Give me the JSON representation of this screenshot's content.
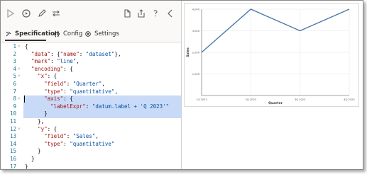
{
  "tabs": [
    {
      "label": "Specification",
      "icon": "tools-icon"
    },
    {
      "label": "Config",
      "icon": "braces-icon"
    },
    {
      "label": "Settings",
      "icon": "gear-icon"
    }
  ],
  "code_lines": [
    {
      "n": "1",
      "segs": [
        [
          "p",
          "{"
        ]
      ]
    },
    {
      "n": "2",
      "segs": [
        [
          "p",
          "  "
        ],
        [
          "k",
          "\"data\""
        ],
        [
          "p",
          ": {"
        ],
        [
          "k",
          "\"name\""
        ],
        [
          "p",
          ": "
        ],
        [
          "s",
          "\"dataset\""
        ],
        [
          "p",
          "},"
        ]
      ]
    },
    {
      "n": "3",
      "segs": [
        [
          "p",
          "  "
        ],
        [
          "k",
          "\"mark\""
        ],
        [
          "p",
          ": "
        ],
        [
          "s",
          "\"line\""
        ],
        [
          "p",
          ","
        ]
      ]
    },
    {
      "n": "4",
      "segs": [
        [
          "p",
          "  "
        ],
        [
          "k",
          "\"encoding\""
        ],
        [
          "p",
          ": {"
        ]
      ]
    },
    {
      "n": "5",
      "segs": [
        [
          "p",
          "    "
        ],
        [
          "k",
          "\"x\""
        ],
        [
          "p",
          ": {"
        ]
      ]
    },
    {
      "n": "6",
      "segs": [
        [
          "p",
          "      "
        ],
        [
          "k",
          "\"field\""
        ],
        [
          "p",
          ": "
        ],
        [
          "s",
          "\"Quarter\""
        ],
        [
          "p",
          ","
        ]
      ]
    },
    {
      "n": "7",
      "segs": [
        [
          "p",
          "      "
        ],
        [
          "k",
          "\"type\""
        ],
        [
          "p",
          ": "
        ],
        [
          "s",
          "\"quantitative\""
        ],
        [
          "p",
          ","
        ]
      ]
    },
    {
      "n": "8",
      "segs": [
        [
          "p",
          "      "
        ],
        [
          "k",
          "\"axis\""
        ],
        [
          "p",
          ": {"
        ]
      ]
    },
    {
      "n": "9",
      "segs": [
        [
          "p",
          "        "
        ],
        [
          "k",
          "\"labelExpr\""
        ],
        [
          "p",
          ": "
        ],
        [
          "s",
          "\"datum.label + 'Q 2023'\""
        ]
      ]
    },
    {
      "n": "10",
      "segs": [
        [
          "p",
          "      }"
        ]
      ]
    },
    {
      "n": "11",
      "segs": [
        [
          "p",
          "    },"
        ]
      ]
    },
    {
      "n": "12",
      "segs": [
        [
          "p",
          "    "
        ],
        [
          "k",
          "\"y\""
        ],
        [
          "p",
          ": {"
        ]
      ]
    },
    {
      "n": "13",
      "segs": [
        [
          "p",
          "      "
        ],
        [
          "k",
          "\"field\""
        ],
        [
          "p",
          ": "
        ],
        [
          "s",
          "\"Sales\""
        ],
        [
          "p",
          ","
        ]
      ]
    },
    {
      "n": "14",
      "segs": [
        [
          "p",
          "      "
        ],
        [
          "k",
          "\"type\""
        ],
        [
          "p",
          ": "
        ],
        [
          "s",
          "\"quantitative\""
        ]
      ]
    },
    {
      "n": "15",
      "segs": [
        [
          "p",
          "    }"
        ]
      ]
    },
    {
      "n": "16",
      "segs": [
        [
          "p",
          "  }"
        ]
      ]
    },
    {
      "n": "17",
      "segs": [
        [
          "p",
          "}"
        ]
      ]
    }
  ],
  "selected_lines": [
    8,
    9,
    10
  ],
  "fold_lines": [
    1,
    4,
    5,
    8,
    12
  ],
  "chart_data": {
    "type": "line",
    "x": [
      1,
      2,
      3,
      4
    ],
    "values": [
      2000,
      4000,
      3000,
      4000
    ],
    "x_ticks": [
      "1Q 2023",
      "2Q 2023",
      "3Q 2023",
      "4Q 2023"
    ],
    "y_ticks": [
      "1,000",
      "2,000",
      "3,000",
      "4,000"
    ],
    "xlabel": "Quarter",
    "ylabel": "Sales",
    "xlim": [
      1,
      4
    ],
    "ylim": [
      0,
      4000
    ],
    "line_color": "#4c78a8",
    "grid": true
  }
}
